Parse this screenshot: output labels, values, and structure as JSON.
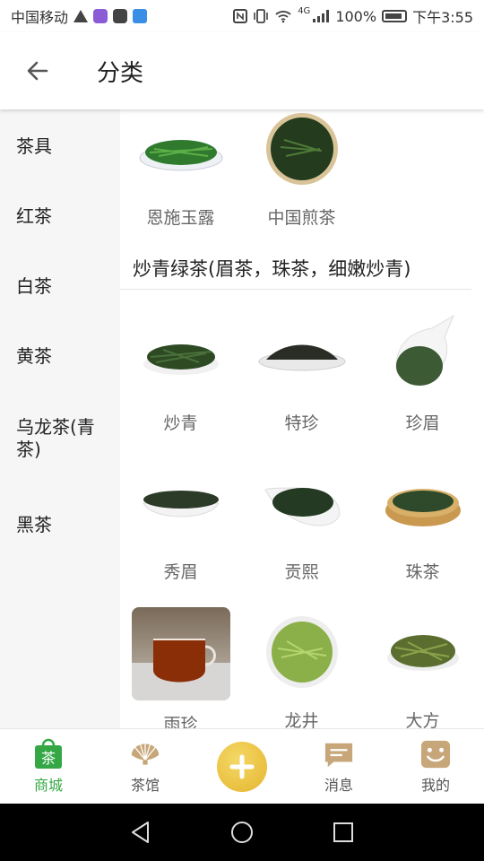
{
  "status_bar": {
    "carrier": "中国移动",
    "network": "4G",
    "battery": "100%",
    "time": "下午3:55"
  },
  "header": {
    "title": "分类",
    "back_icon": "arrow-left-icon"
  },
  "sidebar": {
    "items": [
      {
        "label": "茶具"
      },
      {
        "label": "红茶"
      },
      {
        "label": "白茶"
      },
      {
        "label": "黄茶"
      },
      {
        "label": "乌龙茶(青茶)"
      },
      {
        "label": "黑茶"
      }
    ]
  },
  "content": {
    "top_items": [
      {
        "label": "恩施玉露"
      },
      {
        "label": "中国煎茶"
      }
    ],
    "section_title": "炒青绿茶(眉茶，珠茶，细嫩炒青)",
    "section_items": [
      {
        "label": "炒青"
      },
      {
        "label": "特珍"
      },
      {
        "label": "珍眉"
      },
      {
        "label": "秀眉"
      },
      {
        "label": "贡熙"
      },
      {
        "label": "珠茶"
      },
      {
        "label": "雨珍"
      },
      {
        "label": "龙井"
      },
      {
        "label": "大方"
      }
    ]
  },
  "bottom_nav": {
    "items": [
      {
        "label": "商城",
        "icon": "shop-bag-icon",
        "active": true
      },
      {
        "label": "茶馆",
        "icon": "fan-icon"
      },
      {
        "label": "",
        "icon": "add-icon"
      },
      {
        "label": "消息",
        "icon": "message-icon"
      },
      {
        "label": "我的",
        "icon": "smile-icon"
      }
    ]
  },
  "colors": {
    "accent_green": "#35a845",
    "tan": "#c7a77a",
    "add_yellow": "#e9bf38"
  }
}
